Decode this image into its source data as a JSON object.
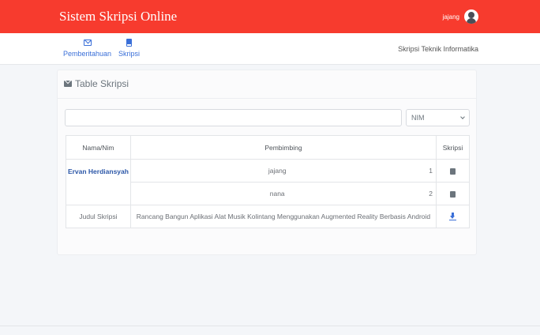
{
  "header": {
    "title": "Sistem Skripsi Online",
    "user_name": "jajang",
    "accent_color": "#f73b2e"
  },
  "nav": {
    "items": [
      {
        "label": "Pemberitahuan",
        "icon": "envelope-icon"
      },
      {
        "label": "Skripsi",
        "icon": "book-icon"
      }
    ],
    "right_text": "Skripsi Teknik Informatika"
  },
  "panel": {
    "title": "Table Skripsi",
    "title_icon": "envelope-icon"
  },
  "search": {
    "value": "",
    "placeholder": ""
  },
  "filter": {
    "selected": "NIM"
  },
  "table": {
    "headers": [
      "Nama/Nim",
      "Pembimbing",
      "Skripsi"
    ],
    "student_name": "Ervan Herdiansyah",
    "supervisors": [
      {
        "name": "jajang",
        "order": "1"
      },
      {
        "name": "nana",
        "order": "2"
      }
    ],
    "thesis_label": "Judul Skripsi",
    "thesis_title": "Rancang Bangun Aplikasi Alat Musik Kolintang Menggunakan Augmented Reality Berbasis Android"
  }
}
